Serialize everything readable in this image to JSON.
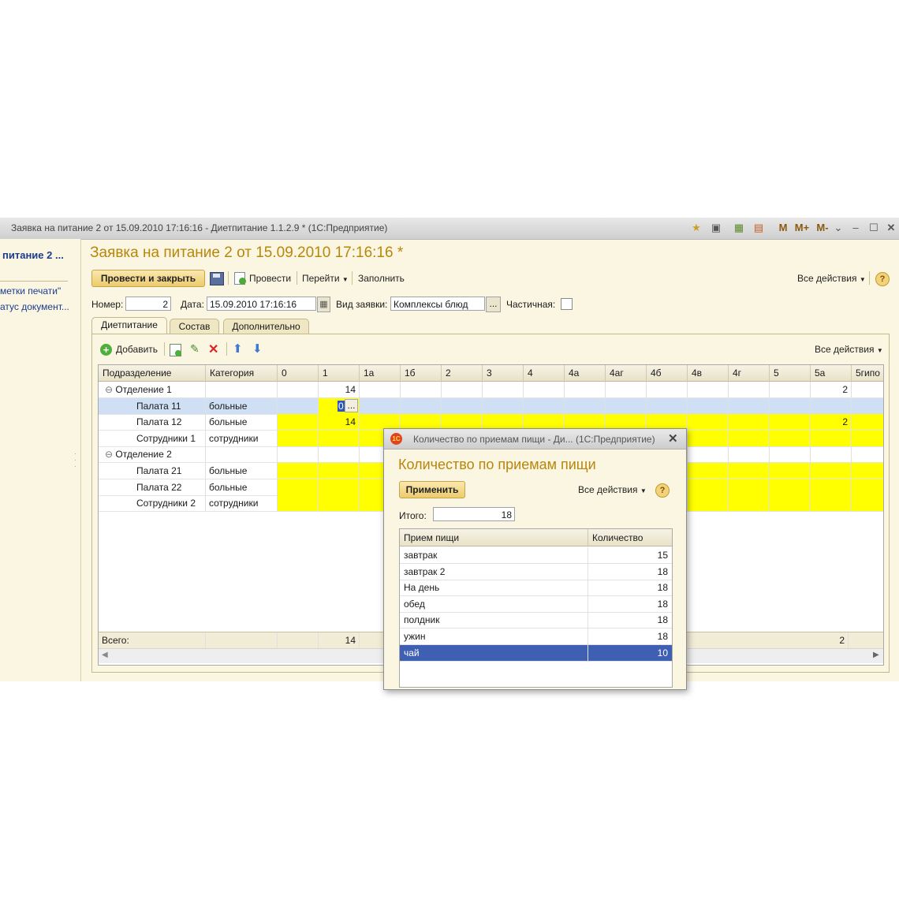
{
  "window": {
    "title": "Заявка на питание 2 от 15.09.2010 17:16:16 - Диетпитание 1.1.2.9 * (1С:Предприятие)",
    "title_icons": [
      "star-icon",
      "doc-icon",
      "calc-icon",
      "calendar-icon"
    ],
    "mem_buttons": [
      "M",
      "M+",
      "M-"
    ]
  },
  "left_panel": {
    "title": "питание 2 ...",
    "links": [
      "метки печати\"",
      "атус документ..."
    ]
  },
  "header": {
    "title": "Заявка на питание 2 от 15.09.2010 17:16:16 *"
  },
  "toolbar": {
    "post_close": "Провести и закрыть",
    "post": "Провести",
    "goto": "Перейти",
    "fill": "Заполнить",
    "all_actions": "Все действия"
  },
  "form": {
    "number_label": "Номер:",
    "number": "2",
    "date_label": "Дата:",
    "date": "15.09.2010 17:16:16",
    "kind_label": "Вид заявки:",
    "kind": "Комплексы блюд",
    "partial_label": "Частичная:",
    "ellipsis": "..."
  },
  "tabs": [
    "Диетпитание",
    "Состав",
    "Дополнительно"
  ],
  "grid_toolbar": {
    "add": "Добавить",
    "all_actions": "Все действия"
  },
  "table": {
    "columns": [
      "Подразделение",
      "Категория",
      "0",
      "1",
      "1а",
      "1б",
      "2",
      "3",
      "4",
      "4а",
      "4аг",
      "4б",
      "4в",
      "4г",
      "5",
      "5а",
      "5гипо"
    ],
    "rows": [
      {
        "name": "Отделение 1",
        "cat": "",
        "v1": "14",
        "v5a": "2"
      },
      {
        "name": "Палата 11",
        "cat": "больные",
        "v1": "0",
        "v5a": ""
      },
      {
        "name": "Палата 12",
        "cat": "больные",
        "v1": "14",
        "v5a": "2"
      },
      {
        "name": "Сотрудники 1",
        "cat": "сотрудники",
        "v1": "",
        "v5a": ""
      },
      {
        "name": "Отделение 2",
        "cat": "",
        "v1": "",
        "v5a": ""
      },
      {
        "name": "Палата 21",
        "cat": "больные",
        "v1": "",
        "v5a": ""
      },
      {
        "name": "Палата 22",
        "cat": "больные",
        "v1": "",
        "v5a": ""
      },
      {
        "name": "Сотрудники 2",
        "cat": "сотрудники",
        "v1": "",
        "v5a": ""
      }
    ],
    "footer": {
      "label": "Всего:",
      "v1": "14",
      "v5a": "2"
    },
    "cell_ellipsis": "..."
  },
  "dialog": {
    "title": "Количество по приемам пищи - Ди... (1С:Предприятие)",
    "heading": "Количество по приемам пищи",
    "apply": "Применить",
    "all_actions": "Все действия",
    "total_label": "Итого:",
    "total": "18",
    "columns": [
      "Прием пищи",
      "Количество"
    ],
    "rows": [
      {
        "meal": "завтрак",
        "qty": "15"
      },
      {
        "meal": "завтрак 2",
        "qty": "18"
      },
      {
        "meal": "На день",
        "qty": "18"
      },
      {
        "meal": "обед",
        "qty": "18"
      },
      {
        "meal": "полдник",
        "qty": "18"
      },
      {
        "meal": "ужин",
        "qty": "18"
      },
      {
        "meal": "чай",
        "qty": "10"
      }
    ]
  },
  "colors": {
    "accent_title": "#b8860b",
    "highlight": "#ffff00",
    "selection": "#3f5fb3"
  }
}
